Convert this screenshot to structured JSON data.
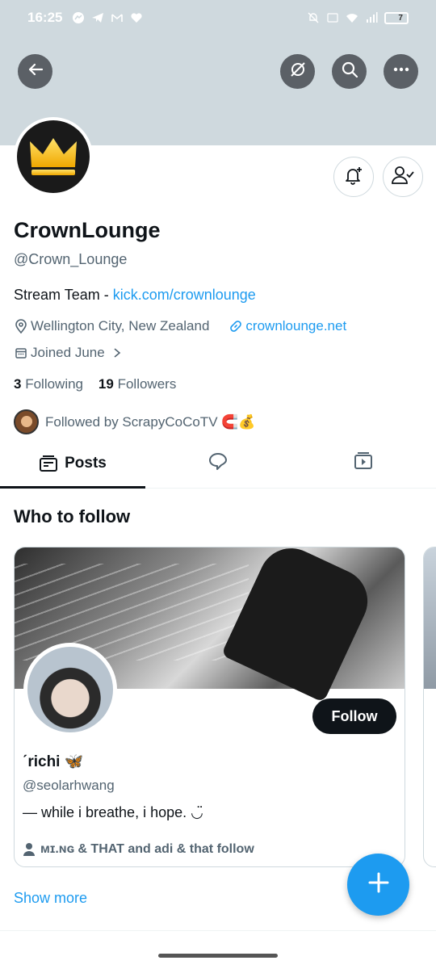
{
  "status_bar": {
    "time": "16:25",
    "battery_level": "7"
  },
  "profile": {
    "display_name": "CrownLounge",
    "handle": "@Crown_Lounge",
    "bio_prefix": "Stream Team - ",
    "bio_link": "kick.com/crownlounge",
    "location": "Wellington City, New Zealand",
    "website": "crownlounge.net",
    "joined": "Joined June",
    "following_count": "3",
    "following_label": "Following",
    "followers_count": "19",
    "followers_label": "Followers",
    "followed_by": "Followed by ScrapyCoCoTV 🧲💰"
  },
  "tabs": [
    {
      "label": "Posts",
      "icon": "posts-icon",
      "active": true
    },
    {
      "label": "",
      "icon": "replies-icon",
      "active": false
    },
    {
      "label": "",
      "icon": "media-icon",
      "active": false
    }
  ],
  "who_to_follow": {
    "title": "Who to follow",
    "card": {
      "name": "ˊrichi 🦋",
      "handle": "@seolarhwang",
      "bio": "— while i breathe, i hope. ◡̈",
      "social_context": "ᴍɪ.ɴɢ & THAT and adi & that follow",
      "follow_label": "Follow"
    },
    "show_more": "Show more"
  },
  "colors": {
    "accent": "#1d9bf0",
    "banner": "#cfd9de",
    "text_primary": "#0f1419",
    "text_secondary": "#536471"
  }
}
